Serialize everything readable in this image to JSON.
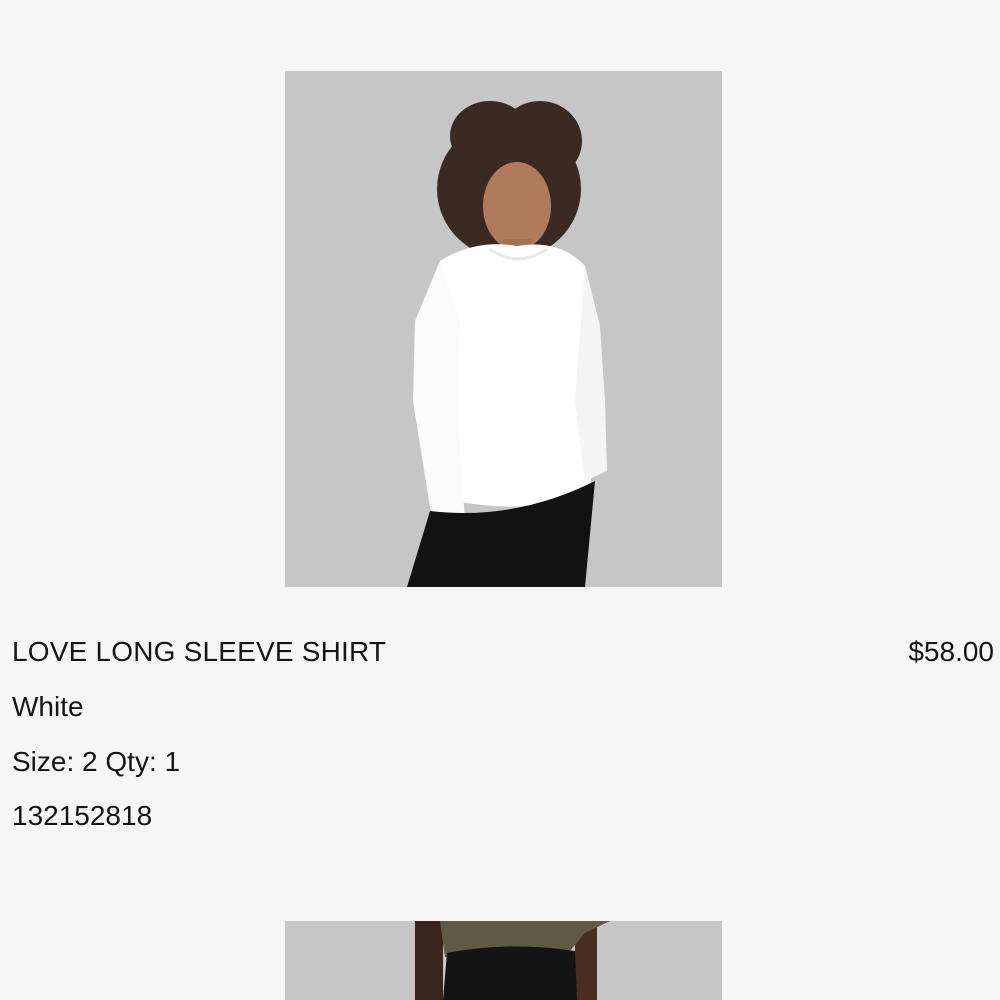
{
  "item": {
    "name": "LOVE LONG SLEEVE SHIRT",
    "price": "$58.00",
    "color": "White",
    "size_qty": "Size: 2 Qty: 1",
    "sku": "132152818",
    "image_icon": "product-photo-woman-white-long-sleeve-shirt"
  },
  "next_item": {
    "image_icon": "product-photo-olive-top-black-leggings"
  },
  "colors": {
    "background": "#f6f6f6",
    "photo_background": "#c7c7c7",
    "text": "#151515"
  }
}
